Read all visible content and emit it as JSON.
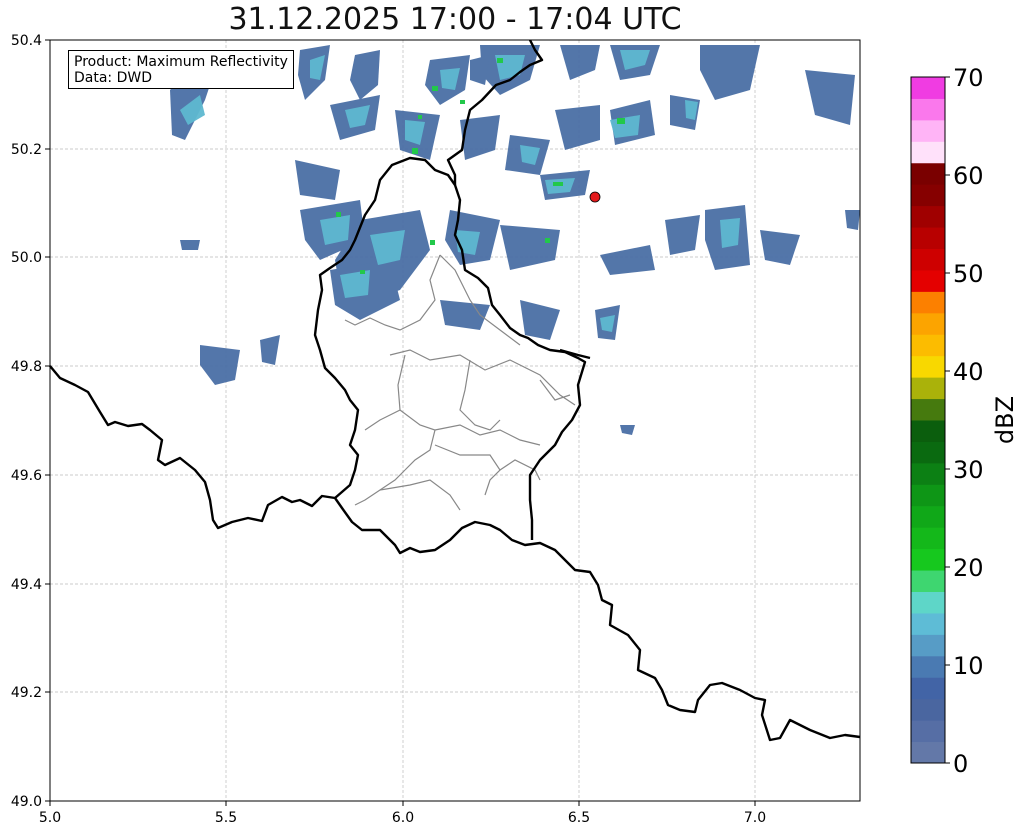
{
  "title": "31.12.2025 17:00 - 17:04 UTC",
  "infobox": {
    "product": "Product: Maximum Reflectivity",
    "source": "Data: DWD"
  },
  "axes": {
    "x_ticks": [
      "5.0",
      "5.5",
      "6.0",
      "6.5",
      "7.0"
    ],
    "y_ticks": [
      "49.0",
      "49.2",
      "49.4",
      "49.6",
      "49.8",
      "50.0",
      "50.2",
      "50.4"
    ],
    "xlim": [
      5.0,
      7.3
    ],
    "ylim": [
      49.0,
      50.4
    ],
    "grid": true
  },
  "marker": {
    "lon": 6.55,
    "lat": 50.11,
    "color": "#e31a1c"
  },
  "colorbar": {
    "label": "dBZ",
    "ticks": [
      "0",
      "10",
      "20",
      "30",
      "40",
      "50",
      "60",
      "70"
    ],
    "range": [
      0,
      70
    ],
    "colors": [
      "#6378a8",
      "#566ea5",
      "#4a66a0",
      "#4264a6",
      "#4a7ab2",
      "#579cc6",
      "#5ebcd6",
      "#5ed6c8",
      "#3ed670",
      "#16c81e",
      "#14b81a",
      "#10a818",
      "#0e9616",
      "#0c8014",
      "#0a6a10",
      "#0b5e0d",
      "#467a0e",
      "#aab20a",
      "#f8d800",
      "#fcbc00",
      "#fca400",
      "#fc8000",
      "#e40000",
      "#ce0000",
      "#b80000",
      "#a00000",
      "#860000",
      "#7a0000",
      "#ffe1fa",
      "#ffb4f6",
      "#fa78ec",
      "#f03ce2"
    ]
  },
  "map_colors": {
    "border": "#000000",
    "admin": "#888888",
    "echo_main": "#4a6fa5",
    "echo_light": "#5eb8d0",
    "echo_green": "#22c84a"
  }
}
